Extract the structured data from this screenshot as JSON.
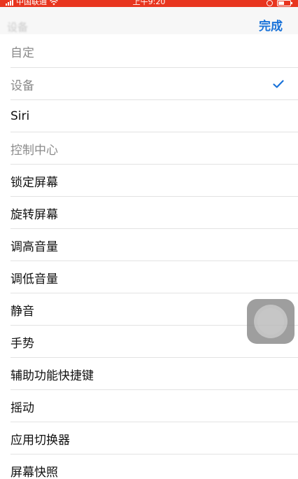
{
  "status_bar": {
    "carrier": "中国联通",
    "time": "上午9:20",
    "bg_color": "#e8351f"
  },
  "nav": {
    "back_label": "设备",
    "done_label": "完成",
    "accent_color": "#1a73d9"
  },
  "items": [
    {
      "label": "自定",
      "dimmed": true,
      "checked": false
    },
    {
      "label": "设备",
      "dimmed": true,
      "checked": true
    },
    {
      "label": "Siri",
      "dimmed": false,
      "checked": false
    },
    {
      "label": "控制中心",
      "dimmed": true,
      "checked": false
    },
    {
      "label": "锁定屏幕",
      "dimmed": false,
      "checked": false
    },
    {
      "label": "旋转屏幕",
      "dimmed": false,
      "checked": false
    },
    {
      "label": "调高音量",
      "dimmed": false,
      "checked": false
    },
    {
      "label": "调低音量",
      "dimmed": false,
      "checked": false
    },
    {
      "label": "静音",
      "dimmed": false,
      "checked": false
    },
    {
      "label": "手势",
      "dimmed": false,
      "checked": false
    },
    {
      "label": "辅助功能快捷键",
      "dimmed": false,
      "checked": false
    },
    {
      "label": "摇动",
      "dimmed": false,
      "checked": false
    },
    {
      "label": "应用切换器",
      "dimmed": false,
      "checked": false
    },
    {
      "label": "屏幕快照",
      "dimmed": false,
      "checked": false
    }
  ],
  "icons": {
    "check": "checkmark-icon",
    "assistive": "assistive-touch-icon",
    "wifi": "wifi-icon",
    "battery": "battery-icon"
  }
}
